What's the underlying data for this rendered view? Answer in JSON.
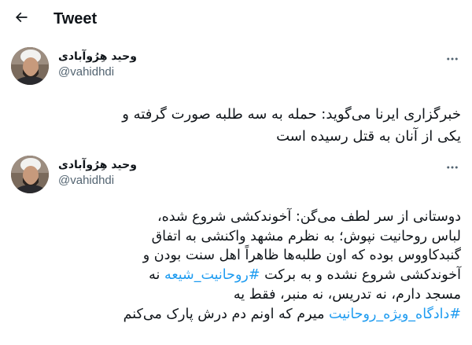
{
  "header": {
    "title": "Tweet",
    "back_icon": "arrow-left-icon"
  },
  "tweet1": {
    "display_name": "وحید هِرُوآبادی",
    "handle": "@vahidhdi",
    "more_icon": "more-horizontal-icon",
    "text_lines": [
      "خبرگزاری ایرنا می‌گوید: حمله به سه طلبه صورت گرفته و",
      "یکی از آنان به قتل رسیده است"
    ]
  },
  "tweet2": {
    "display_name": "وحید هِرُوآبادی",
    "handle": "@vahidhdi",
    "more_icon": "more-horizontal-icon",
    "line1": "دوستانی از سر لطف می‌گن: آخوندکشی شروع شده،",
    "line2": "لباس روحانیت نپوش؛ به نظرم مشهد واکنشی به اتفاق",
    "line3": "گنبدکاووس بوده که اون طلبه‌ها ظاهراً اهل سنت بودن و",
    "line4_pre": "آخوندکشی شروع نشده و به برکت ",
    "line4_tag": "#روحانیت_شیعه",
    "line4_post": " نه",
    "line5": "مسجد دارم، نه تدریس، نه منبر، فقط یه",
    "line6_tag": "#دادگاه_ویژه_روحانیت",
    "line6_post": " میرم که اونم دم درش پارک می‌کنم"
  },
  "colors": {
    "text": "#0f1419",
    "secondary": "#536471",
    "link": "#1d9bf0",
    "background": "#ffffff"
  }
}
